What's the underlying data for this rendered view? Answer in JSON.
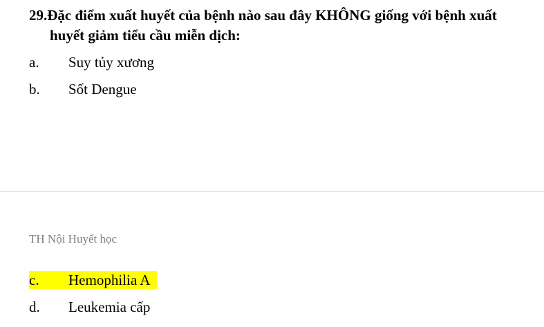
{
  "question": {
    "number": "29.",
    "line1": "Đặc điểm xuất huyết của bệnh nào sau đây KHÔNG giống với bệnh xuất",
    "line2": "huyết giảm tiểu cầu miễn dịch:"
  },
  "options_top": [
    {
      "letter": "a.",
      "text": "Suy tủy xương"
    },
    {
      "letter": "b.",
      "text": "Sốt Dengue"
    }
  ],
  "footer": {
    "text": "TH Nội Huyết học"
  },
  "options_bottom": [
    {
      "letter": "c.",
      "text": "Hemophilia A",
      "highlight_color": "#ffff00"
    },
    {
      "letter": "d.",
      "text": "Leukemia cấp"
    }
  ]
}
